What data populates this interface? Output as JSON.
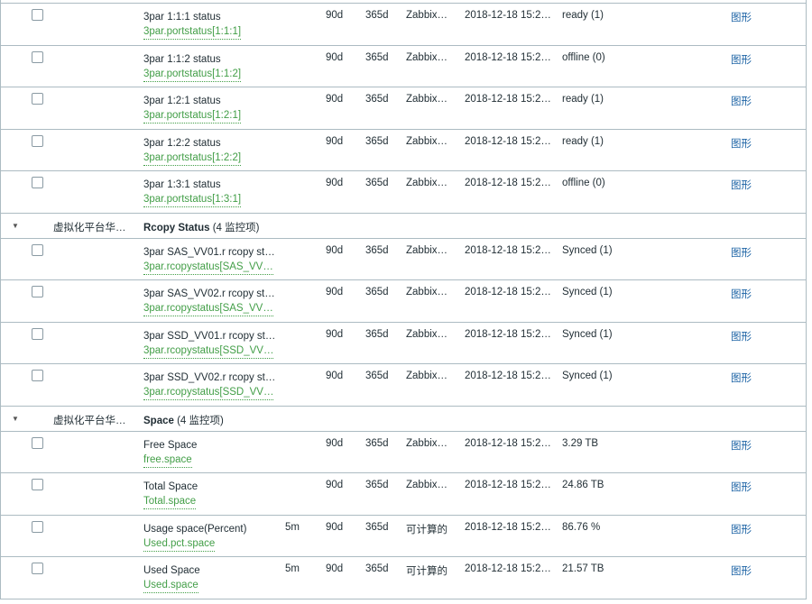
{
  "rows": [
    {
      "kind": "item",
      "name": "3par 1:1:1 status",
      "key": "3par.portstatus[1:1:1]",
      "interval": "",
      "history": "90d",
      "trends": "365d",
      "type": "Zabbix…",
      "last_check": "2018-12-18 15:2…",
      "value": "ready (1)",
      "graph": "图形"
    },
    {
      "kind": "item",
      "name": "3par 1:1:2 status",
      "key": "3par.portstatus[1:1:2]",
      "interval": "",
      "history": "90d",
      "trends": "365d",
      "type": "Zabbix…",
      "last_check": "2018-12-18 15:2…",
      "value": "offline (0)",
      "graph": "图形"
    },
    {
      "kind": "item",
      "name": "3par 1:2:1 status",
      "key": "3par.portstatus[1:2:1]",
      "interval": "",
      "history": "90d",
      "trends": "365d",
      "type": "Zabbix…",
      "last_check": "2018-12-18 15:2…",
      "value": "ready (1)",
      "graph": "图形"
    },
    {
      "kind": "item",
      "name": "3par 1:2:2 status",
      "key": "3par.portstatus[1:2:2]",
      "interval": "",
      "history": "90d",
      "trends": "365d",
      "type": "Zabbix…",
      "last_check": "2018-12-18 15:2…",
      "value": "ready (1)",
      "graph": "图形"
    },
    {
      "kind": "item",
      "name": "3par 1:3:1 status",
      "key": "3par.portstatus[1:3:1]",
      "interval": "",
      "history": "90d",
      "trends": "365d",
      "type": "Zabbix…",
      "last_check": "2018-12-18 15:2…",
      "value": "offline (0)",
      "graph": "图形"
    },
    {
      "kind": "group",
      "host": "虚拟化平台华…",
      "app": "Rcopy Status",
      "count": "(4 监控项)"
    },
    {
      "kind": "item",
      "name": "3par SAS_VV01.r rcopy st…",
      "key": "3par.rcopystatus[SAS_VV…",
      "interval": "",
      "history": "90d",
      "trends": "365d",
      "type": "Zabbix…",
      "last_check": "2018-12-18 15:2…",
      "value": "Synced (1)",
      "graph": "图形"
    },
    {
      "kind": "item",
      "name": "3par SAS_VV02.r rcopy st…",
      "key": "3par.rcopystatus[SAS_VV…",
      "interval": "",
      "history": "90d",
      "trends": "365d",
      "type": "Zabbix…",
      "last_check": "2018-12-18 15:2…",
      "value": "Synced (1)",
      "graph": "图形"
    },
    {
      "kind": "item",
      "name": "3par SSD_VV01.r rcopy st…",
      "key": "3par.rcopystatus[SSD_VV…",
      "interval": "",
      "history": "90d",
      "trends": "365d",
      "type": "Zabbix…",
      "last_check": "2018-12-18 15:2…",
      "value": "Synced (1)",
      "graph": "图形"
    },
    {
      "kind": "item",
      "name": "3par SSD_VV02.r rcopy st…",
      "key": "3par.rcopystatus[SSD_VV…",
      "interval": "",
      "history": "90d",
      "trends": "365d",
      "type": "Zabbix…",
      "last_check": "2018-12-18 15:2…",
      "value": "Synced (1)",
      "graph": "图形"
    },
    {
      "kind": "group",
      "host": "虚拟化平台华…",
      "app": "Space",
      "count": "(4 监控项)"
    },
    {
      "kind": "item",
      "name": "Free Space",
      "key": "free.space",
      "interval": "",
      "history": "90d",
      "trends": "365d",
      "type": "Zabbix…",
      "last_check": "2018-12-18 15:2…",
      "value": "3.29 TB",
      "graph": "图形"
    },
    {
      "kind": "item",
      "name": "Total Space",
      "key": "Total.space",
      "interval": "",
      "history": "90d",
      "trends": "365d",
      "type": "Zabbix…",
      "last_check": "2018-12-18 15:2…",
      "value": "24.86 TB",
      "graph": "图形"
    },
    {
      "kind": "item",
      "name": "Usage space(Percent)",
      "key": "Used.pct.space",
      "interval": "5m",
      "history": "90d",
      "trends": "365d",
      "type": "可计算的",
      "last_check": "2018-12-18 15:2…",
      "value": "86.76 %",
      "graph": "图形"
    },
    {
      "kind": "item",
      "name": "Used Space",
      "key": "Used.space",
      "interval": "5m",
      "history": "90d",
      "trends": "365d",
      "type": "可计算的",
      "last_check": "2018-12-18 15:2…",
      "value": "21.57 TB",
      "graph": "图形"
    }
  ],
  "colors": {
    "key_link": "#429e47",
    "graph_link": "#1f65a6",
    "border": "#acbbc2"
  },
  "icons": {
    "collapse": "triangle-down-icon",
    "checkbox": "checkbox-unchecked"
  }
}
